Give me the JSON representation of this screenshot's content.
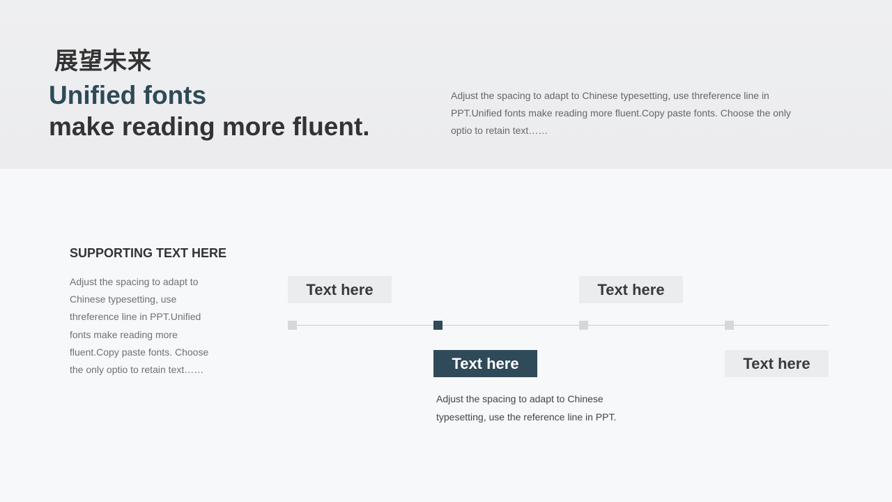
{
  "header": {
    "cn_title": "展望未来",
    "headline_line1": "Unified fonts",
    "headline_line2": "make reading more fluent.",
    "intro": "Adjust the spacing to adapt to Chinese typesetting, use threference line in PPT.Unified fonts make reading more fluent.Copy paste fonts. Choose the only optio to retain text……"
  },
  "supporting": {
    "title": "SUPPORTING TEXT HERE",
    "body": "Adjust the spacing to adapt to Chinese typesetting, use threference line in PPT.Unified fonts make reading more fluent.Copy paste fonts. Choose the only optio to retain text……"
  },
  "timeline": {
    "colors": {
      "active": "#2f4a58",
      "inactive": "#d6d7d9",
      "label_bg": "#ebecee",
      "line": "#c9cbce"
    },
    "items": [
      {
        "label": "Text here",
        "active": false
      },
      {
        "label": "Text here",
        "active": true
      },
      {
        "label": "Text here",
        "active": false
      },
      {
        "label": "Text here",
        "active": false
      }
    ],
    "active_description": "Adjust the spacing to adapt to Chinese typesetting, use the reference line in PPT."
  },
  "colors": {
    "accent": "#2e4a58",
    "text_dark": "#333333",
    "text_muted": "#666666",
    "header_bg": "#eeeff1",
    "page_bg": "#f7f8fa"
  }
}
